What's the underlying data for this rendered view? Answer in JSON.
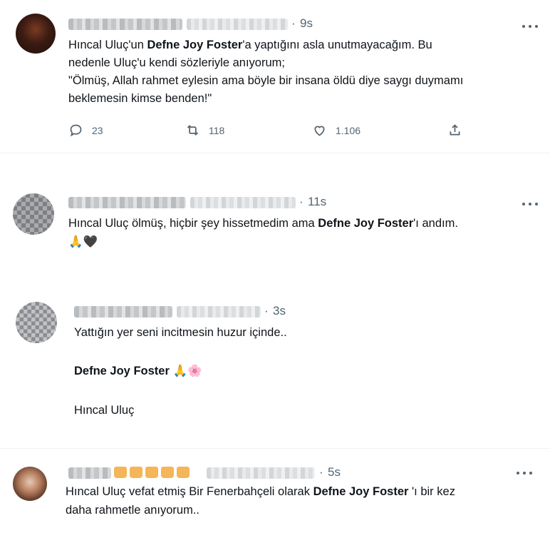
{
  "tweets": [
    {
      "time": "9s",
      "lines": [
        {
          "before": "Hıncal Uluç'un ",
          "bold": "Defne Joy Foster",
          "after": "'a yaptığını asla unutmayacağım. Bu"
        },
        {
          "before": "nedenle Uluç'u kendi sözleriyle anıyorum;",
          "bold": "",
          "after": ""
        },
        {
          "before": "\"Ölmüş, Allah rahmet eylesin ama böyle bir insana öldü diye saygı duymamı",
          "bold": "",
          "after": ""
        },
        {
          "before": "beklemesin kimse benden!\"",
          "bold": "",
          "after": ""
        }
      ],
      "actions": {
        "replies": "23",
        "retweets": "118",
        "likes": "1.106"
      }
    },
    {
      "time": "11s",
      "lines": [
        {
          "before": "Hıncal Uluç ölmüş, hiçbir şey hissetmedim ama ",
          "bold": "Defne Joy Foster",
          "after": "'ı  andım."
        }
      ],
      "emoji": "🙏🖤"
    },
    {
      "time": "3s",
      "lines": [
        {
          "before": "Yattığın yer seni incitmesin huzur içinde..",
          "bold": "",
          "after": ""
        },
        {
          "before": "",
          "bold": "Defne Joy Foster",
          "after": " 🙏🌸"
        },
        {
          "before": "Hıncal Uluç",
          "bold": "",
          "after": ""
        }
      ]
    },
    {
      "time": "5s",
      "lines": [
        {
          "before": "Hıncal Uluç vefat etmiş Bir Fenerbahçeli olarak ",
          "bold": "Defne Joy Foster",
          "after": " 'ı bir kez"
        },
        {
          "before": "daha rahmetle anıyorum..",
          "bold": "",
          "after": ""
        }
      ]
    }
  ],
  "separator": "·",
  "icons": [
    "reply-icon",
    "retweet-icon",
    "like-icon",
    "share-icon",
    "more-icon"
  ],
  "colors": {
    "text": "#0f1419",
    "secondary": "#536471",
    "divider": "#eff3f4"
  }
}
